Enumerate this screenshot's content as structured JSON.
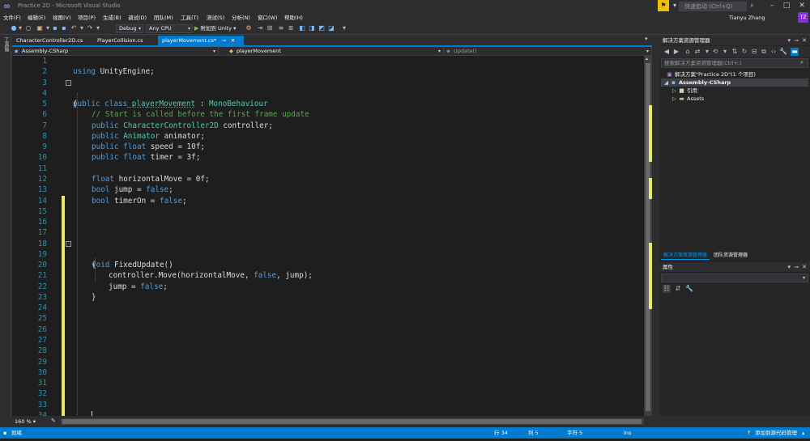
{
  "window": {
    "title": "Practice 2D - Microsoft Visual Studio",
    "quick_launch_placeholder": "快速启动 (Ctrl+Q)",
    "user_name": "Tianyu Zhang",
    "user_initials": "TZ"
  },
  "menu": [
    "文件(F)",
    "编辑(E)",
    "视图(V)",
    "项目(P)",
    "生成(B)",
    "调试(D)",
    "团队(M)",
    "工具(T)",
    "测试(S)",
    "分析(N)",
    "窗口(W)",
    "帮助(H)"
  ],
  "toolbar": {
    "config": "Debug",
    "platform": "Any CPU",
    "run_label": "附加到 Unity"
  },
  "left_strip": {
    "toolbox_label": "工具箱"
  },
  "tabs": [
    {
      "label": "CharacterController2D.cs",
      "active": false
    },
    {
      "label": "PlayerCollision.cs",
      "active": false
    },
    {
      "label": "playerMovement.cs*",
      "active": true
    }
  ],
  "navbar": {
    "project": "Assembly-CSharp",
    "type": "playerMovement",
    "member": "Update()"
  },
  "editor": {
    "zoom": "160 %",
    "lines": [
      {
        "n": "1"
      },
      {
        "n": "2"
      },
      {
        "n": "3"
      },
      {
        "n": "4"
      },
      {
        "n": "5"
      },
      {
        "n": "6"
      },
      {
        "n": "7"
      },
      {
        "n": "8"
      },
      {
        "n": "9"
      },
      {
        "n": "10"
      },
      {
        "n": "11"
      },
      {
        "n": "12"
      },
      {
        "n": "13"
      },
      {
        "n": "14"
      },
      {
        "n": "15"
      },
      {
        "n": "16"
      },
      {
        "n": "17"
      },
      {
        "n": "18"
      },
      {
        "n": "19"
      },
      {
        "n": "20"
      },
      {
        "n": "21"
      },
      {
        "n": "22"
      },
      {
        "n": "23"
      },
      {
        "n": "24"
      },
      {
        "n": "25"
      },
      {
        "n": "26"
      },
      {
        "n": "27"
      },
      {
        "n": "28"
      },
      {
        "n": "29"
      },
      {
        "n": "30"
      },
      {
        "n": "31"
      },
      {
        "n": "32"
      },
      {
        "n": "33"
      },
      {
        "n": "34"
      }
    ],
    "code": {
      "l1_kw": "using",
      "l1_rest": " UnityEngine;",
      "l3_kw": "public class",
      "l3_name": " playerMovement",
      "l3_colon": " : ",
      "l3_base": "MonoBehaviour",
      "l4": "{",
      "l5": "// Start is called before the first frame update",
      "l6_kw": "public",
      "l6_ty": " CharacterController2D",
      "l6_rest": " controller;",
      "l7_kw": "public",
      "l7_ty": " Animator",
      "l7_rest": " animator;",
      "l8_kw": "public float",
      "l8_rest": " speed = 10f;",
      "l9_kw": "public float",
      "l9_rest": " timer = 3f;",
      "l11_kw": "float",
      "l11_rest": " horizontalMove = 0f;",
      "l12_kw": "bool",
      "l12_mid": " jump = ",
      "l12_val": "false",
      "l12_end": ";",
      "l13_kw": "bool",
      "l13_mid": " timerOn = ",
      "l13_val": "false",
      "l13_end": ";",
      "l18_kw": "void",
      "l18_rest": " FixedUpdate()",
      "l19": "{",
      "l20_a": "controller.Move(horizontalMove, ",
      "l20_val": "false",
      "l20_b": ", jump);",
      "l21_a": "jump = ",
      "l21_val": "false",
      "l21_b": ";",
      "l22": "}"
    }
  },
  "solution_explorer": {
    "title": "解决方案资源管理器",
    "search_placeholder": "搜索解决方案资源管理器(Ctrl+;)",
    "tree": [
      {
        "label": "解决方案\"Practice 2D\"(1 个项目)",
        "icon": "solution-icon"
      },
      {
        "label": "Assembly-CSharp",
        "icon": "csharp-project-icon"
      },
      {
        "label": "引用",
        "icon": "references-icon"
      },
      {
        "label": "Assets",
        "icon": "folder-icon"
      }
    ],
    "tabs": [
      "解决方案资源管理器",
      "团队资源管理器"
    ]
  },
  "properties": {
    "title": "属性"
  },
  "status": {
    "ready": "就绪",
    "row": "行 34",
    "col": "列 5",
    "char": "字符 5",
    "mode": "Ins",
    "source_control": "添加到源代码管理"
  },
  "colors": {
    "accent": "#007acc",
    "keyword": "#569cd6",
    "type": "#4ec9b0",
    "comment": "#57a64a",
    "line_number": "#2b91af",
    "change_marker": "#e9e86e"
  }
}
